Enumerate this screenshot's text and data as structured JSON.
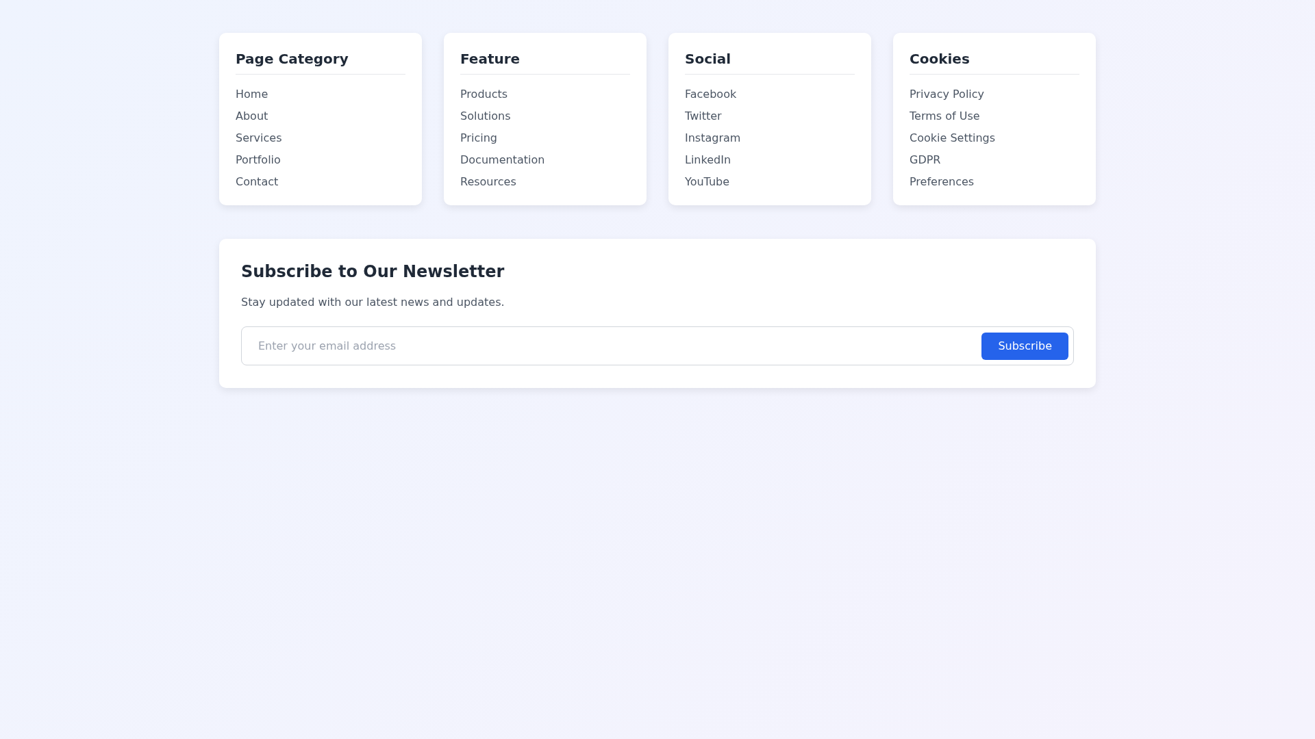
{
  "columns": [
    {
      "title": "Page Category",
      "links": [
        "Home",
        "About",
        "Services",
        "Portfolio",
        "Contact"
      ]
    },
    {
      "title": "Feature",
      "links": [
        "Products",
        "Solutions",
        "Pricing",
        "Documentation",
        "Resources"
      ]
    },
    {
      "title": "Social",
      "links": [
        "Facebook",
        "Twitter",
        "Instagram",
        "LinkedIn",
        "YouTube"
      ]
    },
    {
      "title": "Cookies",
      "links": [
        "Privacy Policy",
        "Terms of Use",
        "Cookie Settings",
        "GDPR",
        "Preferences"
      ]
    }
  ],
  "newsletter": {
    "title": "Subscribe to Our Newsletter",
    "description": "Stay updated with our latest news and updates.",
    "placeholder": "Enter your email address",
    "button": "Subscribe"
  }
}
